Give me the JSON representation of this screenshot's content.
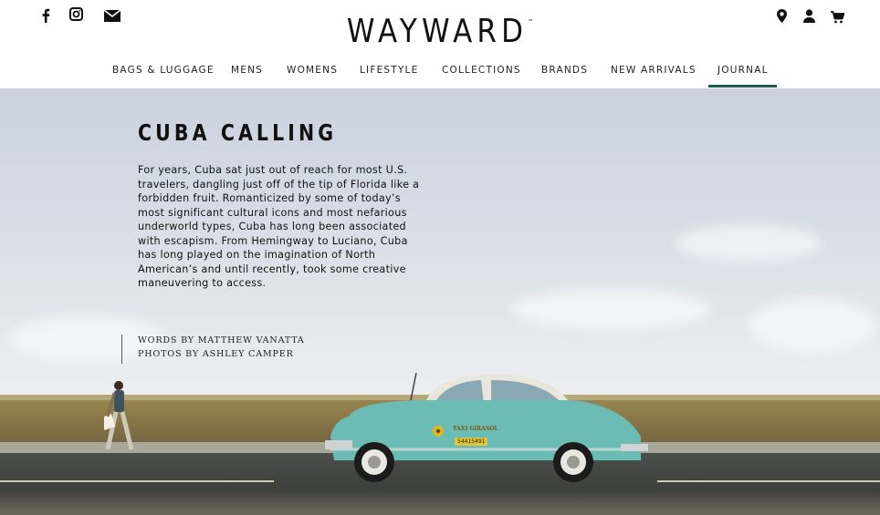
{
  "brand": {
    "logo_text": "WAYWARD",
    "trademark": "™"
  },
  "social": {
    "icons": [
      "facebook-icon",
      "instagram-icon",
      "mail-icon"
    ]
  },
  "utility": {
    "icons": [
      "location-icon",
      "account-icon",
      "cart-icon"
    ]
  },
  "nav": {
    "items": [
      "BAGS & LUGGAGE",
      "MENS",
      "WOMENS",
      "LIFESTYLE",
      "COLLECTIONS",
      "BRANDS",
      "NEW ARRIVALS",
      "JOURNAL"
    ],
    "active": "JOURNAL",
    "accent_color": "#1f5c4d"
  },
  "hero": {
    "title": "CUBA CALLING",
    "body": "For years, Cuba sat just out of reach for most U.S. travelers, dangling just off of the tip of Florida like a forbidden fruit. Romanticized by some of today’s most significant cultural icons and most nefarious underworld types, Cuba has long been associated with escapism. From Hemingway to Luciano, Cuba has long played on the imagination of North American’s and until recently, took some creative maneuvering to access.",
    "words_by": "WORDS BY MATTHEW VANATTA",
    "photos_by": "PHOTOS BY ASHLEY CAMPER",
    "taxi_sign": "TAXI GIRASOL",
    "taxi_plate": "54415491",
    "car_color": "#6cbcb6"
  }
}
